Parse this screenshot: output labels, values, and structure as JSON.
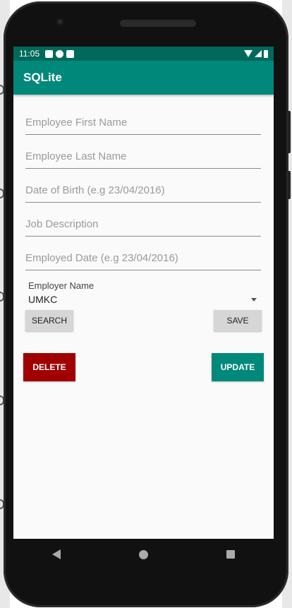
{
  "status_bar": {
    "time": "11:05",
    "icons_left": [
      "gmail-icon",
      "circle-p-icon",
      "sd-card-icon"
    ],
    "icons_right": [
      "wifi-icon",
      "signal-icon",
      "battery-icon"
    ]
  },
  "app_bar": {
    "title": "SQLite"
  },
  "form": {
    "first_name": {
      "placeholder": "Employee First Name",
      "value": ""
    },
    "last_name": {
      "placeholder": "Employee Last Name",
      "value": ""
    },
    "dob": {
      "placeholder": "Date of Birth (e.g 23/04/2016)",
      "value": ""
    },
    "job": {
      "placeholder": "Job Description",
      "value": ""
    },
    "employed_date": {
      "placeholder": "Employed Date (e.g 23/04/2016)",
      "value": ""
    },
    "employer": {
      "label": "Employer Name",
      "selected": "UMKC"
    }
  },
  "buttons": {
    "search": "SEARCH",
    "save": "SAVE",
    "delete": "DELETE",
    "update": "UPDATE"
  },
  "colors": {
    "status_bar": "#00695c",
    "app_bar": "#00897b",
    "delete": "#a00000",
    "update": "#00897b"
  }
}
